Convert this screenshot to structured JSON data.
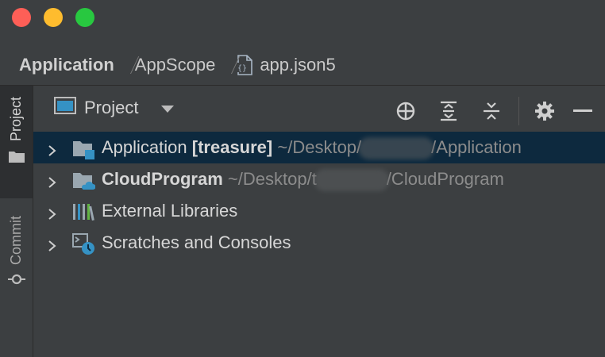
{
  "window": {
    "traffic_lights": {
      "close_color": "#fe5f57",
      "minimize_color": "#febc2e",
      "maximize_color": "#28c840"
    }
  },
  "breadcrumb": {
    "items": [
      {
        "label": "Application"
      },
      {
        "label": "AppScope"
      },
      {
        "label": "app.json5",
        "icon": "json-file-icon"
      }
    ]
  },
  "side_strip": {
    "tabs": [
      {
        "label": "Project",
        "icon": "folder-icon",
        "active": true
      },
      {
        "label": "Commit",
        "icon": "commit-icon",
        "active": false
      }
    ]
  },
  "panel": {
    "title": "Project",
    "toolbar_icons": [
      "locate-icon",
      "expand-all-icon",
      "collapse-all-icon",
      "gear-icon",
      "minimize-icon"
    ]
  },
  "tree": {
    "rows": [
      {
        "name": "Application",
        "suffix": "[treasure]",
        "path_start": "~/Desktop/",
        "path_end": "/Application",
        "selected": true,
        "icon": "module-folder-icon"
      },
      {
        "name": "CloudProgram",
        "path_start": "~/Desktop/t",
        "path_end": "/CloudProgram",
        "selected": false,
        "icon": "cloud-folder-icon"
      },
      {
        "name": "External Libraries",
        "selected": false,
        "icon": "libraries-icon"
      },
      {
        "name": "Scratches and Consoles",
        "selected": false,
        "icon": "scratches-icon"
      }
    ]
  },
  "colors": {
    "background": "#3c3f41",
    "selection": "#0d293e",
    "accent_blue": "#3592c4"
  }
}
